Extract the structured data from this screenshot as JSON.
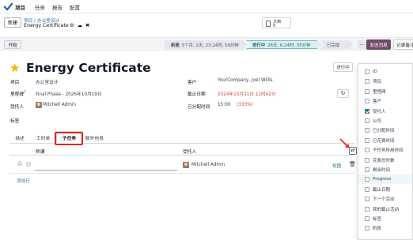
{
  "nav": {
    "items": [
      "项目",
      "任务",
      "报告",
      "配置"
    ]
  },
  "control": {
    "new_label": "新建",
    "breadcrumb_parent": "项目 / 办公室设计",
    "breadcrumb_current": "Energy Certificate",
    "doc": {
      "line1": "文档",
      "line2": "0"
    }
  },
  "statusbar": {
    "start_label": "开始",
    "stages": [
      {
        "name": "新建",
        "detail": "5个月, 2天, 23:24时, 59分钟"
      },
      {
        "name": "进行中",
        "detail": "26天, 6:24时, 35分钟"
      },
      {
        "name": "已完成",
        "detail": ""
      }
    ],
    "more_label": "...",
    "send_label": "发送消息",
    "note_label": "记录备注"
  },
  "form": {
    "title": "Energy Certificate",
    "state_label": "进行中",
    "fields": {
      "project_label": "项目",
      "project_value": "办公室设计",
      "milestone_label": "里程碑",
      "milestone_value": "Final Phase - 2026年10月19日",
      "assignee_label": "受托人",
      "assignee_value": "Mitchell Admin",
      "tags_label": "标签",
      "customer_label": "客户",
      "customer_value": "YourCompany, Joel Willis",
      "deadline_label": "截止日期",
      "deadline_value": "2024年10月21日 11时42分",
      "time_label": "已分配时间",
      "time_value": "15:00",
      "time_pct": "(333%)"
    }
  },
  "tabs": [
    "描述",
    "工时单",
    "子任务",
    "额外信息"
  ],
  "subtasks": {
    "col_name": "称谓",
    "col_assignee": "受托人",
    "row": {
      "assignee": "Mitchell Admin",
      "view": "视图"
    },
    "add_line": "添加行"
  },
  "column_picker": {
    "options": [
      {
        "label": "ID",
        "checked": false
      },
      {
        "label": "项目",
        "checked": false
      },
      {
        "label": "里程碑",
        "checked": false
      },
      {
        "label": "客户",
        "checked": false
      },
      {
        "label": "受托人",
        "checked": true
      },
      {
        "label": "公司",
        "checked": false
      },
      {
        "label": "已分配时间",
        "checked": false
      },
      {
        "label": "已花费时间",
        "checked": false
      },
      {
        "label": "子任务所用时间",
        "checked": false
      },
      {
        "label": "花费总时数",
        "checked": false
      },
      {
        "label": "剩余时间",
        "checked": false
      },
      {
        "label": "Progress",
        "checked": false,
        "active": true
      },
      {
        "label": "截止日期",
        "checked": false
      },
      {
        "label": "下一个活动",
        "checked": false
      },
      {
        "label": "我的截止活动",
        "checked": false
      },
      {
        "label": "标签",
        "checked": false
      },
      {
        "label": "阶段",
        "checked": false
      }
    ]
  },
  "colors": {
    "accent": "#714b67",
    "teal": "#227c88",
    "danger": "#d14343",
    "star": "#f5b301"
  }
}
